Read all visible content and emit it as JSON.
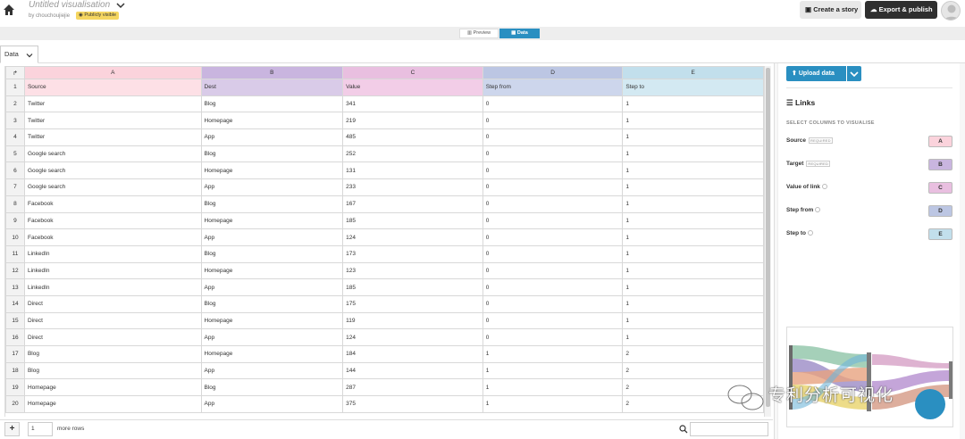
{
  "header": {
    "title": "Untitled visualisation",
    "byline": "by chouchoujiejie",
    "visibility_badge": "Publicly visible",
    "create_story_label": "Create a story",
    "export_label": "Export & publish"
  },
  "mode_toggle": {
    "preview_label": "Preview",
    "data_label": "Data"
  },
  "tabs": {
    "data_label": "Data"
  },
  "grid": {
    "corner_glyph": "↱",
    "column_letters": [
      "A",
      "B",
      "C",
      "D",
      "E"
    ],
    "column_colors": [
      "#fde0e6",
      "#d9cbe8",
      "#f2cde7",
      "#cdd6ec",
      "#d3e9f2"
    ],
    "column_header_colors": [
      "#fbd3dc",
      "#c9b5df",
      "#e9bfe0",
      "#bcc6e3",
      "#c2dfec"
    ],
    "header_row": {
      "num": "1",
      "cells": [
        "Source",
        "Dest",
        "Value",
        "Step from",
        "Step to"
      ]
    },
    "rows": [
      {
        "num": "2",
        "cells": [
          "Twitter",
          "Blog",
          "341",
          "0",
          "1"
        ]
      },
      {
        "num": "3",
        "cells": [
          "Twitter",
          "Homepage",
          "219",
          "0",
          "1"
        ]
      },
      {
        "num": "4",
        "cells": [
          "Twitter",
          "App",
          "485",
          "0",
          "1"
        ]
      },
      {
        "num": "5",
        "cells": [
          "Google search",
          "Blog",
          "252",
          "0",
          "1"
        ]
      },
      {
        "num": "6",
        "cells": [
          "Google search",
          "Homepage",
          "131",
          "0",
          "1"
        ]
      },
      {
        "num": "7",
        "cells": [
          "Google search",
          "App",
          "233",
          "0",
          "1"
        ]
      },
      {
        "num": "8",
        "cells": [
          "Facebook",
          "Blog",
          "167",
          "0",
          "1"
        ]
      },
      {
        "num": "9",
        "cells": [
          "Facebook",
          "Homepage",
          "185",
          "0",
          "1"
        ]
      },
      {
        "num": "10",
        "cells": [
          "Facebook",
          "App",
          "124",
          "0",
          "1"
        ]
      },
      {
        "num": "11",
        "cells": [
          "LinkedIn",
          "Blog",
          "173",
          "0",
          "1"
        ]
      },
      {
        "num": "12",
        "cells": [
          "LinkedIn",
          "Homepage",
          "123",
          "0",
          "1"
        ]
      },
      {
        "num": "13",
        "cells": [
          "LinkedIn",
          "App",
          "185",
          "0",
          "1"
        ]
      },
      {
        "num": "14",
        "cells": [
          "Direct",
          "Blog",
          "175",
          "0",
          "1"
        ]
      },
      {
        "num": "15",
        "cells": [
          "Direct",
          "Homepage",
          "119",
          "0",
          "1"
        ]
      },
      {
        "num": "16",
        "cells": [
          "Direct",
          "App",
          "124",
          "0",
          "1"
        ]
      },
      {
        "num": "17",
        "cells": [
          "Blog",
          "Homepage",
          "184",
          "1",
          "2"
        ]
      },
      {
        "num": "18",
        "cells": [
          "Blog",
          "App",
          "144",
          "1",
          "2"
        ]
      },
      {
        "num": "19",
        "cells": [
          "Homepage",
          "Blog",
          "287",
          "1",
          "2"
        ]
      },
      {
        "num": "20",
        "cells": [
          "Homepage",
          "App",
          "375",
          "1",
          "2"
        ]
      }
    ]
  },
  "footer": {
    "add_label": "+",
    "rows_value": "1",
    "more_rows_label": "more rows"
  },
  "panel": {
    "upload_label": "Upload data",
    "links_title": "Links",
    "select_columns_label": "SELECT COLUMNS TO VISUALISE",
    "required_tag": "REQUIRED",
    "bindings": [
      {
        "label": "Source",
        "required": true,
        "column": "A",
        "color": "#fbd3dc"
      },
      {
        "label": "Target",
        "required": true,
        "column": "B",
        "color": "#c9b5df"
      },
      {
        "label": "Value of link",
        "required": false,
        "column": "C",
        "color": "#e9bfe0"
      },
      {
        "label": "Step from",
        "required": false,
        "column": "D",
        "color": "#bcc6e3"
      },
      {
        "label": "Step to",
        "required": false,
        "column": "E",
        "color": "#c2dfec"
      }
    ]
  },
  "watermark": {
    "text": "专利分析可视化"
  }
}
